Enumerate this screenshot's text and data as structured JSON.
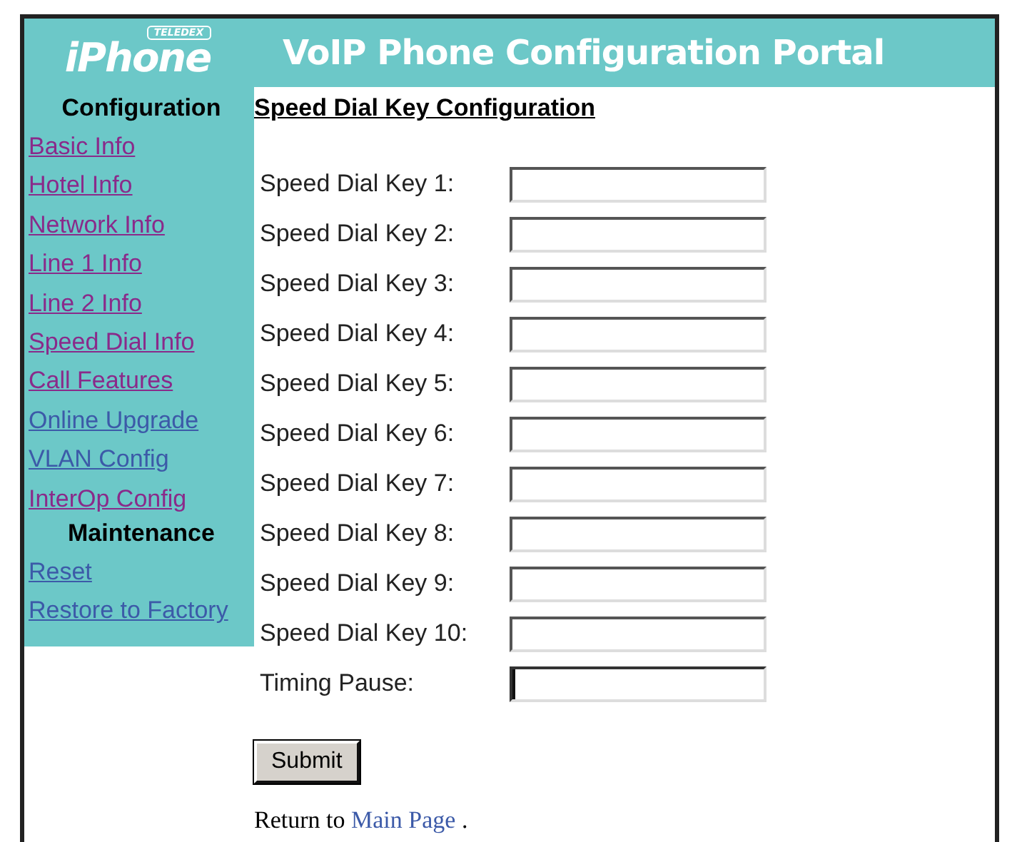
{
  "header": {
    "logo": {
      "badge": "TELEDEX",
      "text": "iPhone"
    },
    "title": "VoIP Phone Configuration Portal"
  },
  "sidebar": {
    "sections": [
      {
        "heading": "Configuration",
        "links": [
          {
            "label": "Basic Info",
            "visited": true
          },
          {
            "label": "Hotel Info",
            "visited": true
          },
          {
            "label": "Network Info",
            "visited": true
          },
          {
            "label": "Line 1 Info",
            "visited": true
          },
          {
            "label": "Line 2 Info",
            "visited": true
          },
          {
            "label": "Speed Dial Info",
            "visited": true
          },
          {
            "label": "Call Features",
            "visited": true
          },
          {
            "label": "Online Upgrade",
            "visited": false
          },
          {
            "label": "VLAN Config",
            "visited": false
          },
          {
            "label": "InterOp Config",
            "visited": true
          }
        ]
      },
      {
        "heading": "Maintenance",
        "links": [
          {
            "label": "Reset",
            "visited": false
          },
          {
            "label": "Restore to Factory",
            "visited": false
          }
        ]
      }
    ]
  },
  "content": {
    "title": "Speed Dial Key Configuration",
    "fields": [
      {
        "label": "Speed Dial Key 1:",
        "focused": false
      },
      {
        "label": "Speed Dial Key 2:",
        "focused": false
      },
      {
        "label": "Speed Dial Key 3:",
        "focused": false
      },
      {
        "label": "Speed Dial Key 4:",
        "focused": false
      },
      {
        "label": "Speed Dial Key 5:",
        "focused": false
      },
      {
        "label": "Speed Dial Key 6:",
        "focused": false
      },
      {
        "label": "Speed Dial Key 7:",
        "focused": false
      },
      {
        "label": "Speed Dial Key 8:",
        "focused": false
      },
      {
        "label": "Speed Dial Key 9:",
        "focused": false
      },
      {
        "label": "Speed Dial Key 10:",
        "focused": false
      },
      {
        "label": "Timing Pause:",
        "focused": true
      }
    ],
    "submit": "Submit",
    "footer": {
      "prefix": "Return to",
      "link": "Main Page",
      "suffix": "."
    }
  }
}
